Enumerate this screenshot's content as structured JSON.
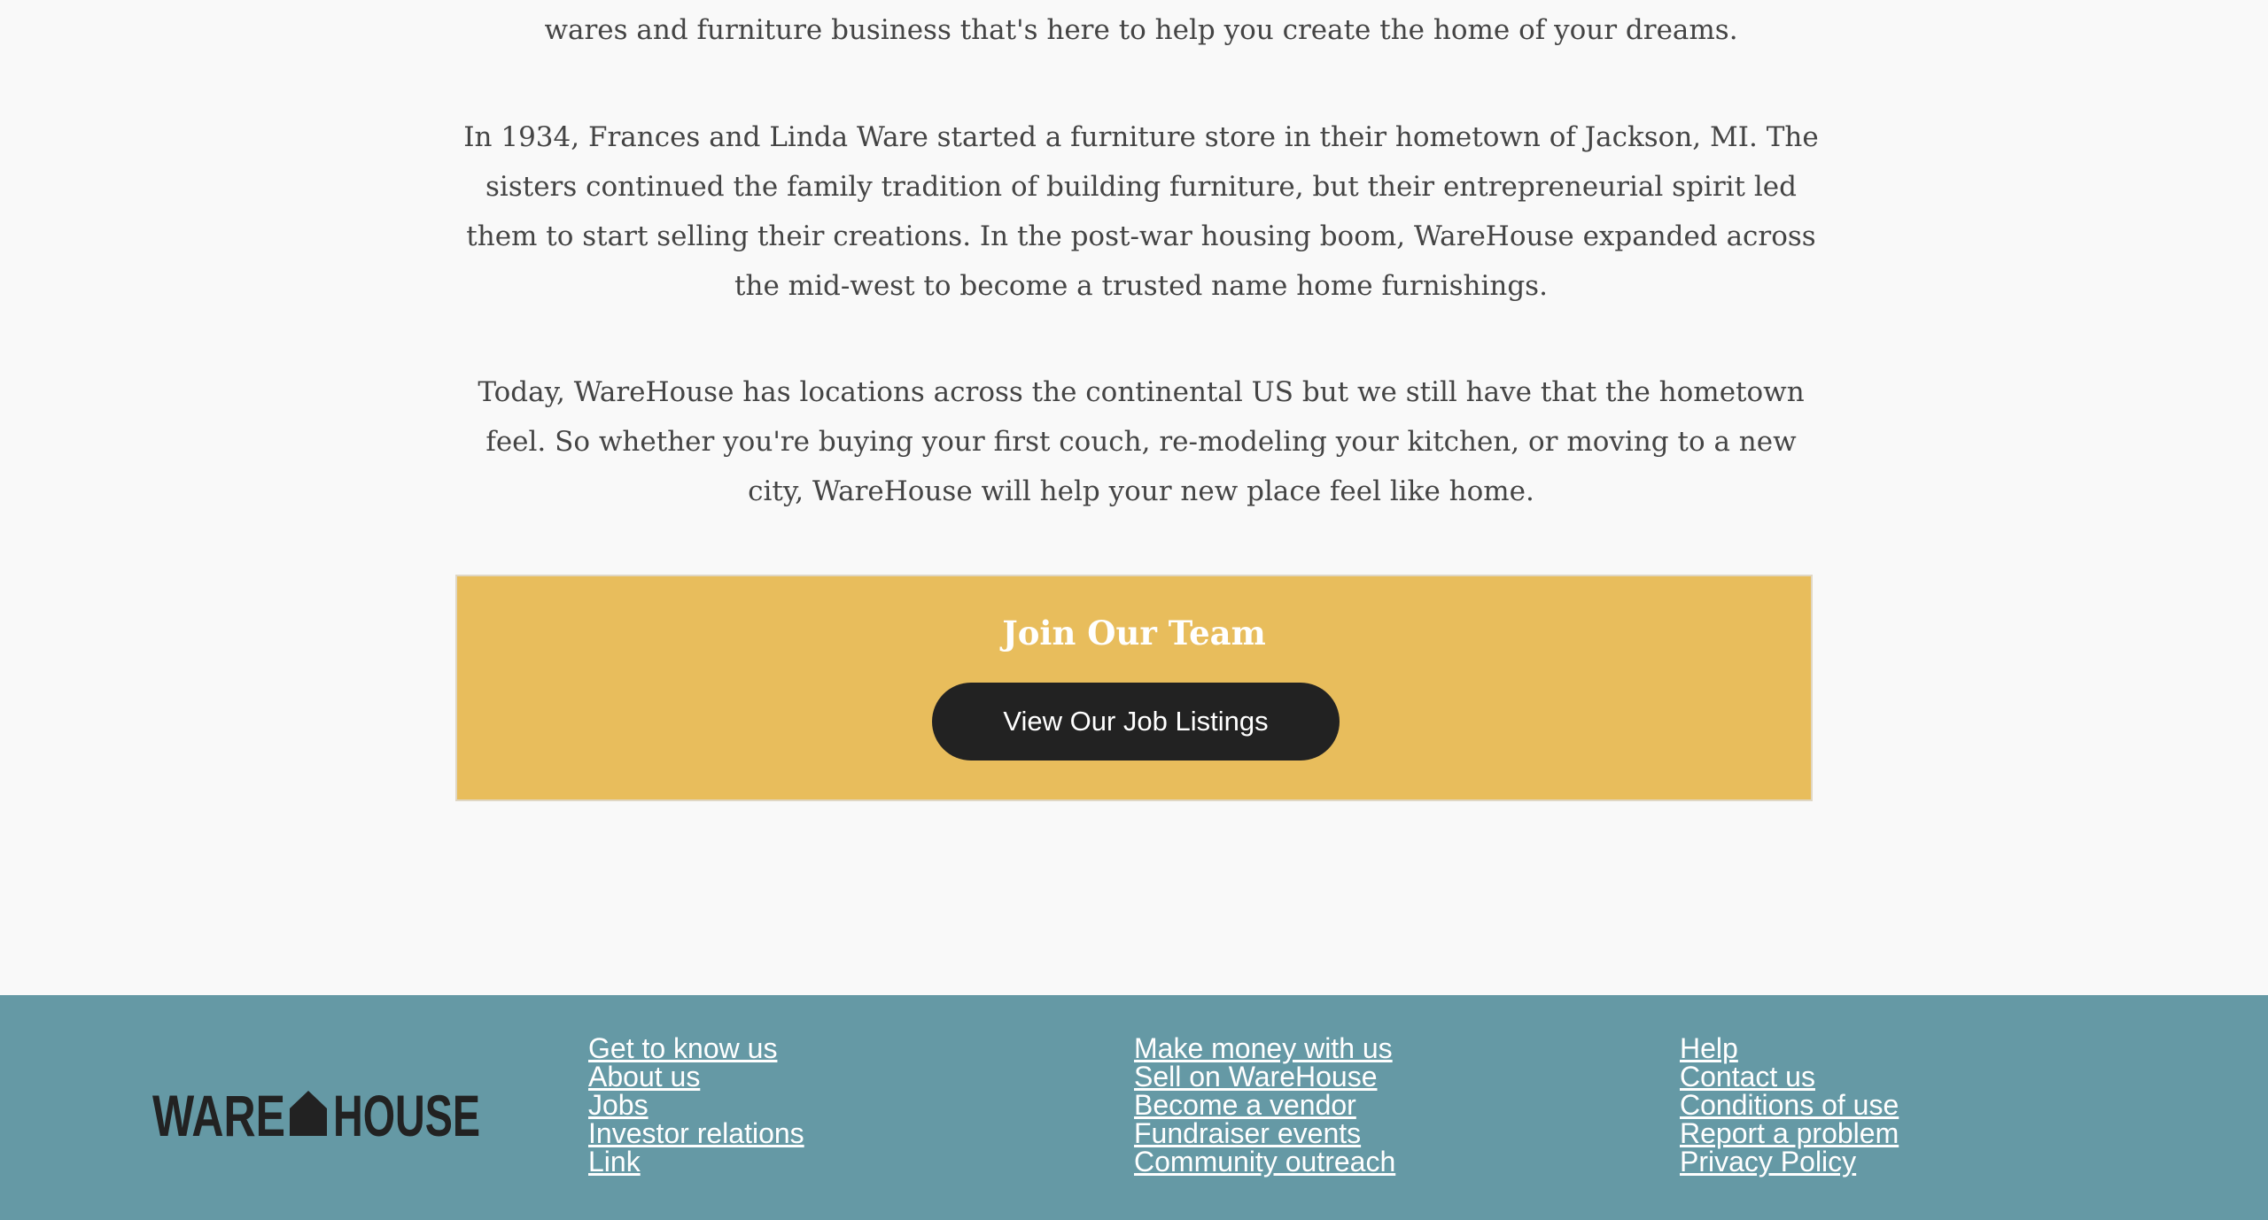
{
  "about": {
    "paragraphs": [
      "wares and furniture business that's here to help you create the home of your dreams.",
      "In 1934, Frances and Linda Ware started a furniture store in their hometown of Jackson, MI. The sisters continued the family tradition of building furniture, but their entrepreneurial spirit led them to start selling their creations. In the post-war housing boom, WareHouse expanded across the mid-west to become a trusted name home furnishings.",
      "Today, WareHouse has locations across the continental US but we still have that the hometown feel. So whether you're buying your first couch, re-modeling your kitchen, or moving to a new city, WareHouse will help your new place feel like home."
    ]
  },
  "cta": {
    "title": "Join Our Team",
    "button_label": "View Our Job Listings"
  },
  "footer": {
    "logo_text_left": "WARE",
    "logo_text_right": "HOUSE",
    "columns": [
      {
        "links": [
          "Get to know us",
          "About us",
          "Jobs",
          "Investor relations",
          "Link"
        ]
      },
      {
        "links": [
          "Make money with us",
          "Sell on WareHouse",
          "Become a vendor",
          "Fundraiser events",
          "Community outreach"
        ]
      },
      {
        "links": [
          "Help",
          "Contact us",
          "Conditions of use",
          "Report a problem",
          "Privacy Policy"
        ]
      }
    ]
  },
  "colors": {
    "page_background": "#f9f9f9",
    "body_text": "#444444",
    "cta_background": "#e8bd5c",
    "button_background": "#222222",
    "footer_background": "#6599a5",
    "footer_link": "#ffffff",
    "logo": "#222222"
  }
}
